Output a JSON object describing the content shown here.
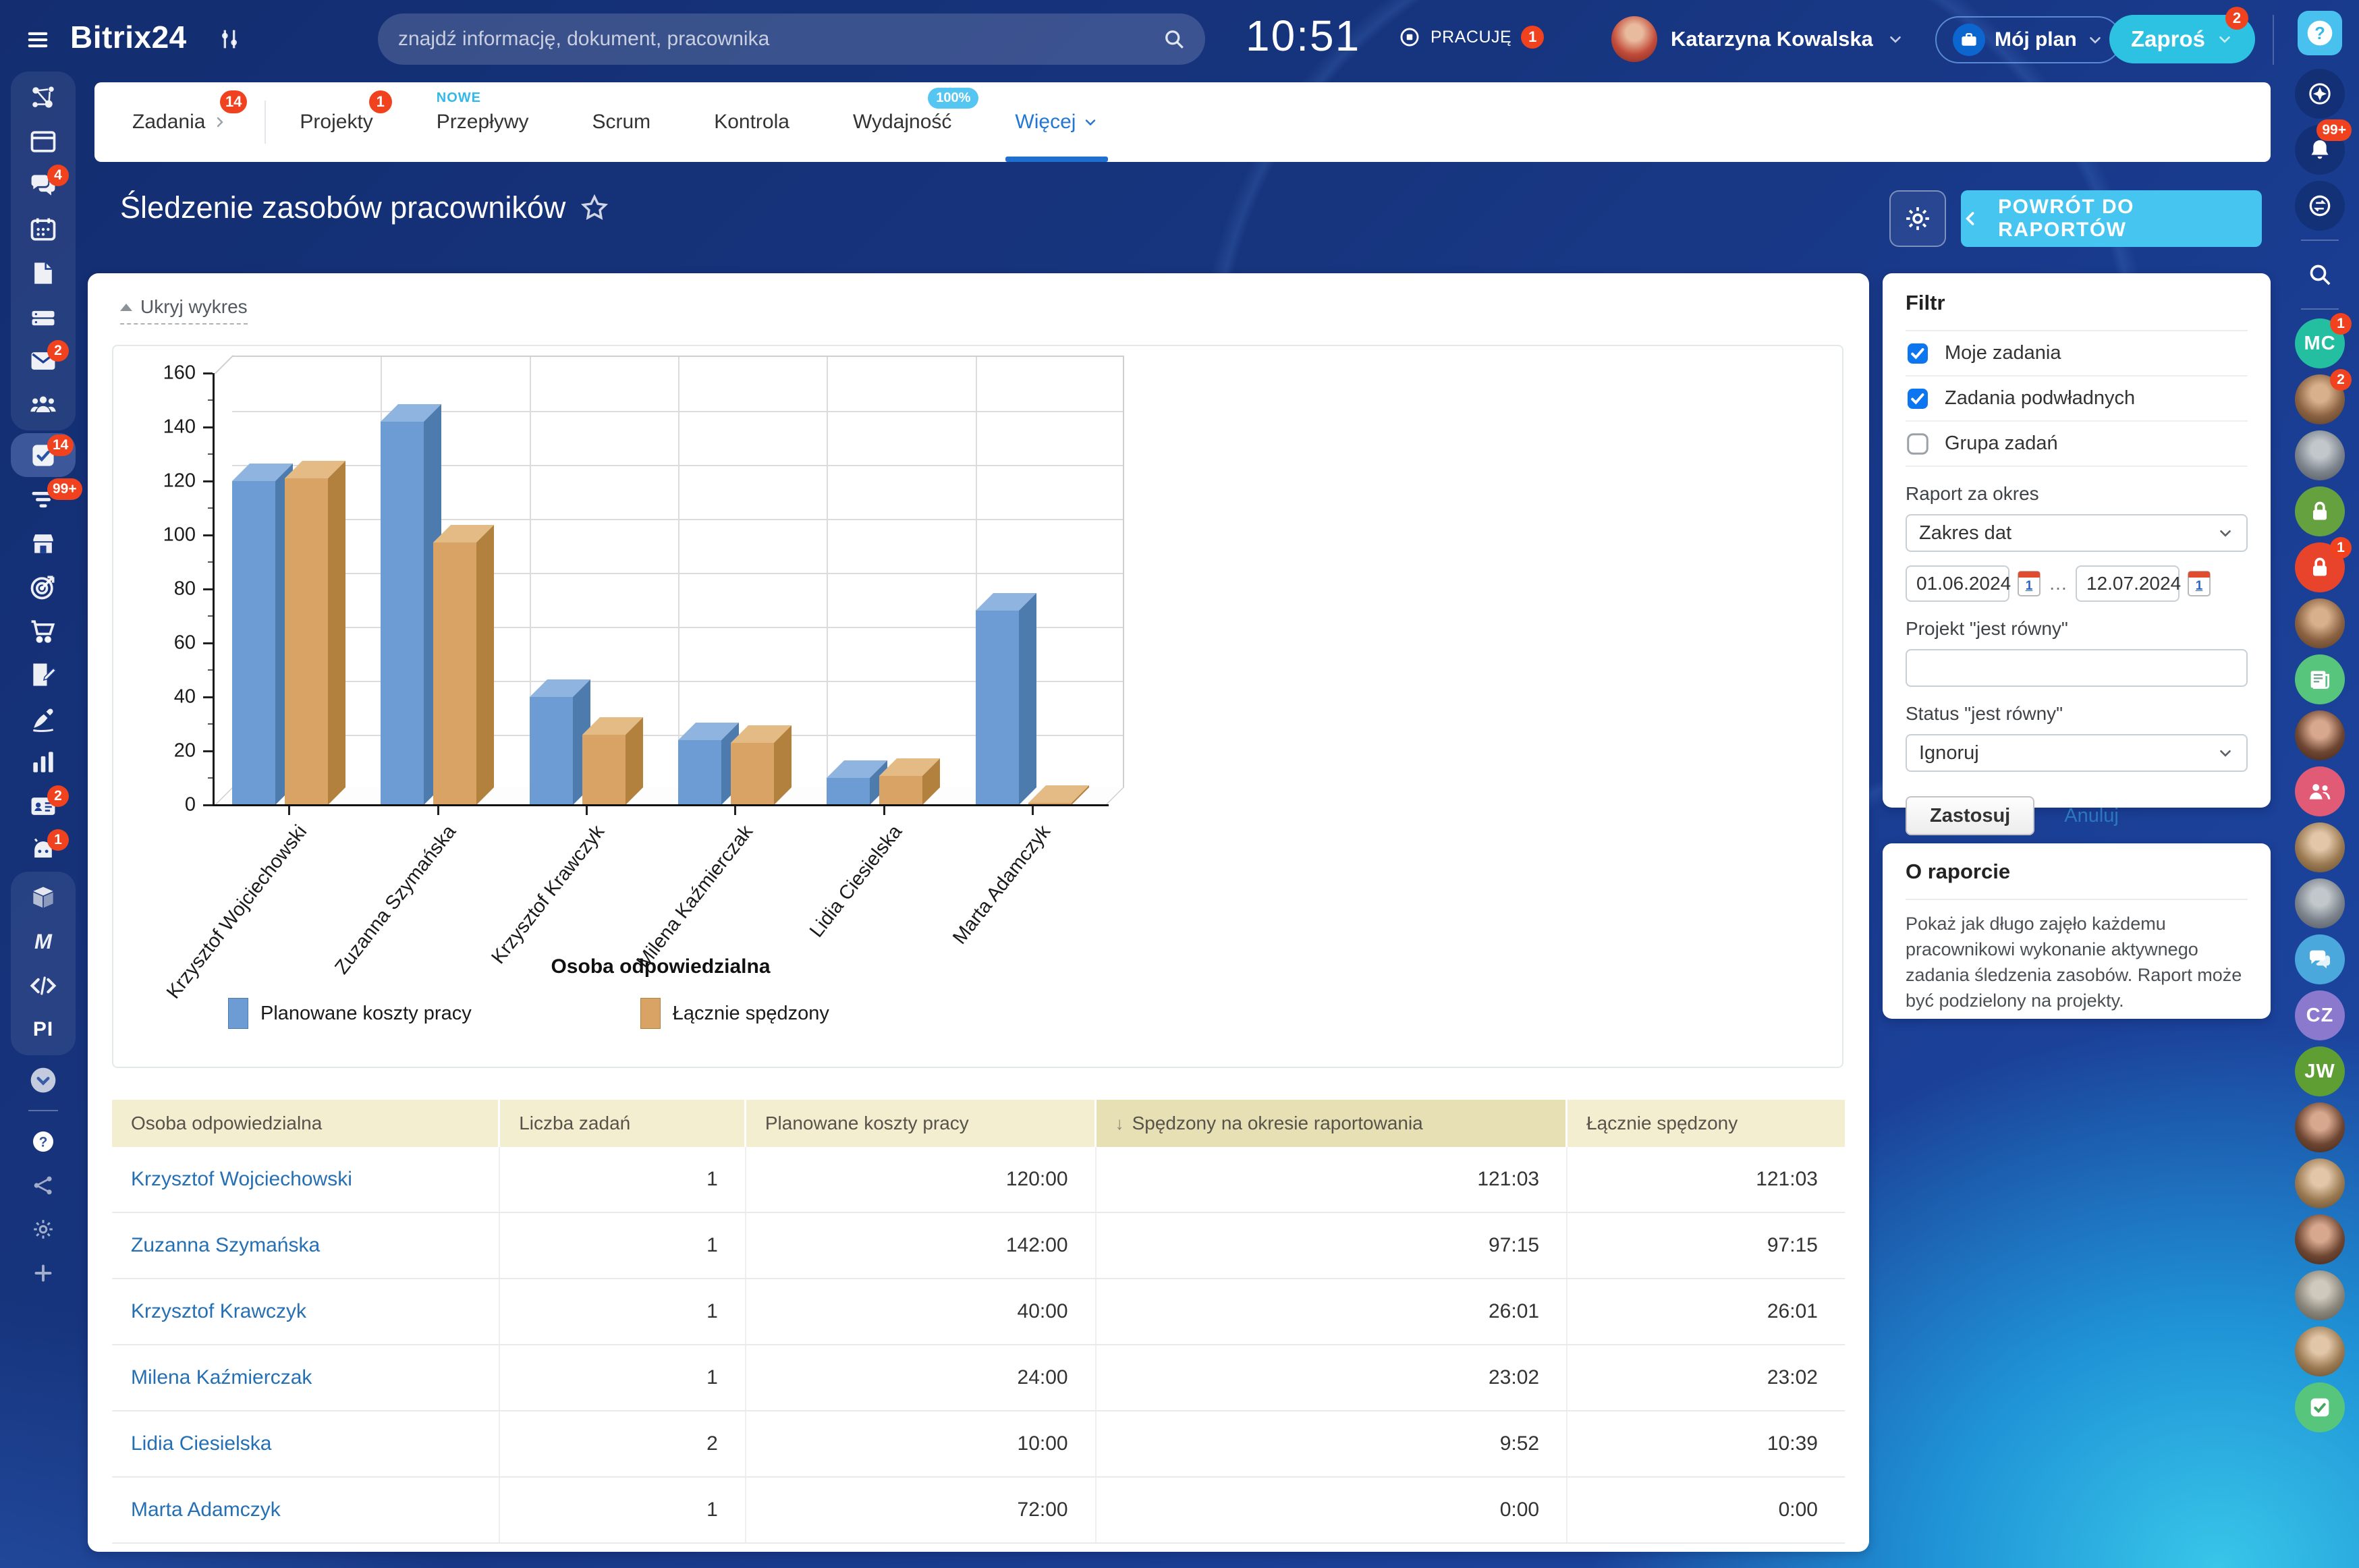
{
  "app": {
    "logo": "Bitrix24",
    "help_label": "?"
  },
  "topbar": {
    "search_placeholder": "znajdź informację, dokument, pracownika",
    "clock": "10:51",
    "status_label": "PRACUJĘ",
    "status_badge": "1",
    "user_name": "Katarzyna Kowalska",
    "plan_button": "Mój plan",
    "invite_button": "Zaproś",
    "invite_badge": "2"
  },
  "tabs": [
    {
      "label": "Zadania",
      "badge": "14",
      "arrow": true
    },
    {
      "label": "Projekty",
      "badge": "1"
    },
    {
      "label": "Przepływy",
      "tag": "NOWE"
    },
    {
      "label": "Scrum"
    },
    {
      "label": "Kontrola"
    },
    {
      "label": "Wydajność",
      "pill": "100%"
    },
    {
      "label": "Więcej",
      "active": true,
      "chevron": true
    }
  ],
  "page": {
    "title": "Śledzenie zasobów pracowników",
    "back_button": "POWRÓT DO RAPORTÓW",
    "hide_chart": "Ukryj wykres"
  },
  "chart_data": {
    "type": "bar",
    "categories": [
      "Krzysztof Wojciechowski",
      "Zuzanna Szymańska",
      "Krzysztof Krawczyk",
      "Milena Kaźmierczak",
      "Lidia Ciesielska",
      "Marta Adamczyk"
    ],
    "series": [
      {
        "name": "Planowane koszty pracy",
        "values": [
          120,
          142,
          40,
          24,
          10,
          72
        ],
        "color": "#6d9bd3",
        "color_top": "#90b4e0",
        "color_side": "#4e7bae"
      },
      {
        "name": "Łącznie spędzony",
        "values": [
          121.1,
          97.3,
          26,
          23,
          10.7,
          0
        ],
        "color": "#d9a365",
        "color_top": "#e4bb85",
        "color_side": "#b2813e"
      }
    ],
    "xlabel": "Osoba odpowiedzialna",
    "ylabel": "",
    "ylim": [
      0,
      160
    ],
    "ytick_step": 20,
    "grid": true,
    "legend_position": "bottom"
  },
  "table": {
    "columns": [
      {
        "label": "Osoba odpowiedzialna"
      },
      {
        "label": "Liczba zadań"
      },
      {
        "label": "Planowane koszty pracy"
      },
      {
        "label": "Spędzony na okresie raportowania",
        "sorted": "desc"
      },
      {
        "label": "Łącznie spędzony"
      }
    ],
    "rows": [
      [
        "Krzysztof Wojciechowski",
        "1",
        "120:00",
        "121:03",
        "121:03"
      ],
      [
        "Zuzanna Szymańska",
        "1",
        "142:00",
        "97:15",
        "97:15"
      ],
      [
        "Krzysztof Krawczyk",
        "1",
        "40:00",
        "26:01",
        "26:01"
      ],
      [
        "Milena Kaźmierczak",
        "1",
        "24:00",
        "23:02",
        "23:02"
      ],
      [
        "Lidia Ciesielska",
        "2",
        "10:00",
        "9:52",
        "10:39"
      ],
      [
        "Marta Adamczyk",
        "1",
        "72:00",
        "0:00",
        "0:00"
      ]
    ]
  },
  "filter": {
    "title": "Filtr",
    "checkboxes": [
      {
        "label": "Moje zadania",
        "checked": true
      },
      {
        "label": "Zadania podwładnych",
        "checked": true
      },
      {
        "label": "Grupa zadań",
        "checked": false
      }
    ],
    "period_label": "Raport za okres",
    "period_value": "Zakres dat",
    "date_from": "01.06.2024",
    "date_to": "12.07.2024",
    "date_separator": "…",
    "calendar_day": "1",
    "project_label": "Projekt \"jest równy\"",
    "project_value": "",
    "status_label": "Status \"jest równy\"",
    "status_value": "Ignoruj",
    "apply": "Zastosuj",
    "cancel": "Anuluj"
  },
  "about": {
    "title": "O raporcie",
    "text": "Pokaż jak długo zajęło każdemu pracownikowi wykonanie aktywnego zadania śledzenia zasobów. Raport może być podzielony na projekty."
  },
  "left_rail": {
    "items": [
      {
        "icon": "network",
        "section": "a"
      },
      {
        "icon": "feed",
        "section": "a"
      },
      {
        "icon": "chat",
        "badge": "4",
        "section": "a"
      },
      {
        "icon": "calendar",
        "section": "a"
      },
      {
        "icon": "doc",
        "section": "a"
      },
      {
        "icon": "drive",
        "section": "a"
      },
      {
        "icon": "mail",
        "badge": "2",
        "section": "a"
      },
      {
        "icon": "people",
        "section": "a"
      },
      {
        "icon": "tasks",
        "badge": "14",
        "active": true
      },
      {
        "icon": "funnel",
        "badge": "99+"
      },
      {
        "icon": "store"
      },
      {
        "icon": "target"
      },
      {
        "icon": "cart"
      },
      {
        "icon": "doc-edit"
      },
      {
        "icon": "pen"
      },
      {
        "icon": "chart"
      },
      {
        "icon": "id-card",
        "badge": "2"
      },
      {
        "icon": "robot",
        "badge": "1"
      },
      {
        "icon": "cube",
        "section": "b"
      },
      {
        "icon": "m-logo",
        "section": "b"
      },
      {
        "icon": "code",
        "section": "b"
      },
      {
        "icon": "pi",
        "text": "PI",
        "section": "b"
      },
      {
        "icon": "chevron-circle"
      },
      {
        "divider": true
      },
      {
        "icon": "help",
        "dim": true
      },
      {
        "icon": "nodes",
        "dim": true
      },
      {
        "icon": "gear",
        "dim": true
      },
      {
        "icon": "plus",
        "dim": true
      }
    ]
  },
  "right_rail": {
    "items": [
      {
        "icon": "compass",
        "dark": true
      },
      {
        "icon": "bell",
        "badge": "99+",
        "dark": true
      },
      {
        "icon": "history",
        "dark": true
      },
      {
        "divider": true
      },
      {
        "icon": "search",
        "bare": true
      },
      {
        "divider": true
      },
      {
        "type": "initials",
        "label": "MC",
        "color": "#23bfa0",
        "badge": "1"
      },
      {
        "type": "avatar",
        "badge": "2"
      },
      {
        "type": "avatar"
      },
      {
        "icon": "lock",
        "color": "#66a13f"
      },
      {
        "icon": "lock",
        "color": "#e8432b",
        "badge": "1"
      },
      {
        "type": "avatar"
      },
      {
        "icon": "news",
        "color": "#58c57c"
      },
      {
        "type": "avatar"
      },
      {
        "icon": "people-pair",
        "color": "#e25b76"
      },
      {
        "type": "avatar"
      },
      {
        "type": "avatar"
      },
      {
        "icon": "chat-bubbles",
        "color": "#4aa8dd"
      },
      {
        "type": "initials",
        "label": "CZ",
        "color": "#8b79ce"
      },
      {
        "type": "initials",
        "label": "JW",
        "color": "#5f9e33"
      },
      {
        "type": "avatar"
      },
      {
        "type": "avatar"
      },
      {
        "type": "avatar"
      },
      {
        "type": "avatar"
      },
      {
        "type": "avatar"
      },
      {
        "icon": "check-square",
        "color": "#58c57c"
      }
    ]
  }
}
